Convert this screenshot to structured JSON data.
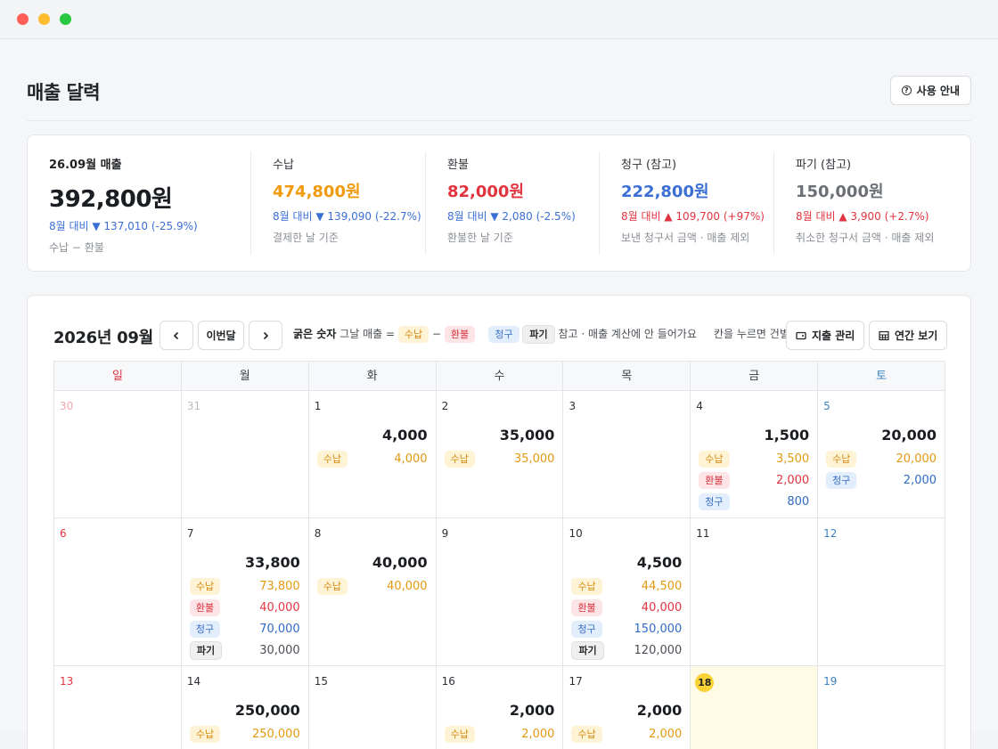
{
  "page": {
    "title": "매출 달력",
    "help_label": "사용 안내"
  },
  "summary": {
    "main": {
      "label": "26.09월 매출",
      "value": "392,800원",
      "delta": "8월 대비 ▼ 137,010 (-25.9%)",
      "note": "수납 − 환불"
    },
    "cols": [
      {
        "label": "수납",
        "value": "474,800원",
        "delta": "8월 대비 ▼ 139,090 (-22.7%)",
        "note": "결제한 날 기준",
        "color": "#f29a0e",
        "dir": "down"
      },
      {
        "label": "환불",
        "value": "82,000원",
        "delta": "8월 대비 ▼ 2,080 (-2.5%)",
        "note": "환불한 날 기준",
        "color": "#e2343f",
        "dir": "down"
      },
      {
        "label": "청구 (참고)",
        "value": "222,800원",
        "delta": "8월 대비 ▲ 109,700 (+97%)",
        "note": "보낸 청구서 금액 · 매출 제외",
        "color": "#3b6fd4",
        "dir": "up"
      },
      {
        "label": "파기 (참고)",
        "value": "150,000원",
        "delta": "8월 대비 ▲ 3,900 (+2.7%)",
        "note": "취소한 청구서 금액 · 매출 제외",
        "color": "#6b7077",
        "dir": "up"
      }
    ]
  },
  "toolbar": {
    "month_title": "2026년 09월",
    "prev_icon": "chevron-left-icon",
    "this_month_label": "이번달",
    "next_icon": "chevron-right-icon",
    "legend_bold": "굵은 숫자",
    "legend_text": "그날 매출 =",
    "legend_minus": "−",
    "chip_su": "수납",
    "chip_hw": "환불",
    "chip_cg": "청구",
    "chip_pg": "파기",
    "legend_ref": "참고 · 매출 계산에 안 들어가요",
    "legend_click": "칸을 누르면 건별 내역",
    "expense_label": "지출 관리",
    "yearly_label": "연간 보기"
  },
  "weekdays": [
    "일",
    "월",
    "화",
    "수",
    "목",
    "금",
    "토"
  ],
  "weeks": [
    [
      {
        "day": "30",
        "other": true
      },
      {
        "day": "31",
        "other": true
      },
      {
        "day": "1",
        "total": "4,000",
        "entries": [
          [
            "수납",
            "4,000"
          ]
        ]
      },
      {
        "day": "2",
        "total": "35,000",
        "entries": [
          [
            "수납",
            "35,000"
          ]
        ]
      },
      {
        "day": "3"
      },
      {
        "day": "4",
        "total": "1,500",
        "entries": [
          [
            "수납",
            "3,500"
          ],
          [
            "환불",
            "2,000"
          ],
          [
            "청구",
            "800"
          ]
        ]
      },
      {
        "day": "5",
        "total": "20,000",
        "entries": [
          [
            "수납",
            "20,000"
          ],
          [
            "청구",
            "2,000"
          ]
        ]
      }
    ],
    [
      {
        "day": "6"
      },
      {
        "day": "7",
        "total": "33,800",
        "entries": [
          [
            "수납",
            "73,800"
          ],
          [
            "환불",
            "40,000"
          ],
          [
            "청구",
            "70,000"
          ],
          [
            "파기",
            "30,000"
          ]
        ]
      },
      {
        "day": "8",
        "total": "40,000",
        "entries": [
          [
            "수납",
            "40,000"
          ]
        ]
      },
      {
        "day": "9"
      },
      {
        "day": "10",
        "total": "4,500",
        "entries": [
          [
            "수납",
            "44,500"
          ],
          [
            "환불",
            "40,000"
          ],
          [
            "청구",
            "150,000"
          ],
          [
            "파기",
            "120,000"
          ]
        ]
      },
      {
        "day": "11"
      },
      {
        "day": "12"
      }
    ],
    [
      {
        "day": "13"
      },
      {
        "day": "14",
        "total": "250,000",
        "entries": [
          [
            "수납",
            "250,000"
          ]
        ]
      },
      {
        "day": "15"
      },
      {
        "day": "16",
        "total": "2,000",
        "entries": [
          [
            "수납",
            "2,000"
          ]
        ]
      },
      {
        "day": "17",
        "total": "2,000",
        "entries": [
          [
            "수납",
            "2,000"
          ]
        ]
      },
      {
        "day": "18",
        "today": true
      },
      {
        "day": "19"
      }
    ]
  ]
}
